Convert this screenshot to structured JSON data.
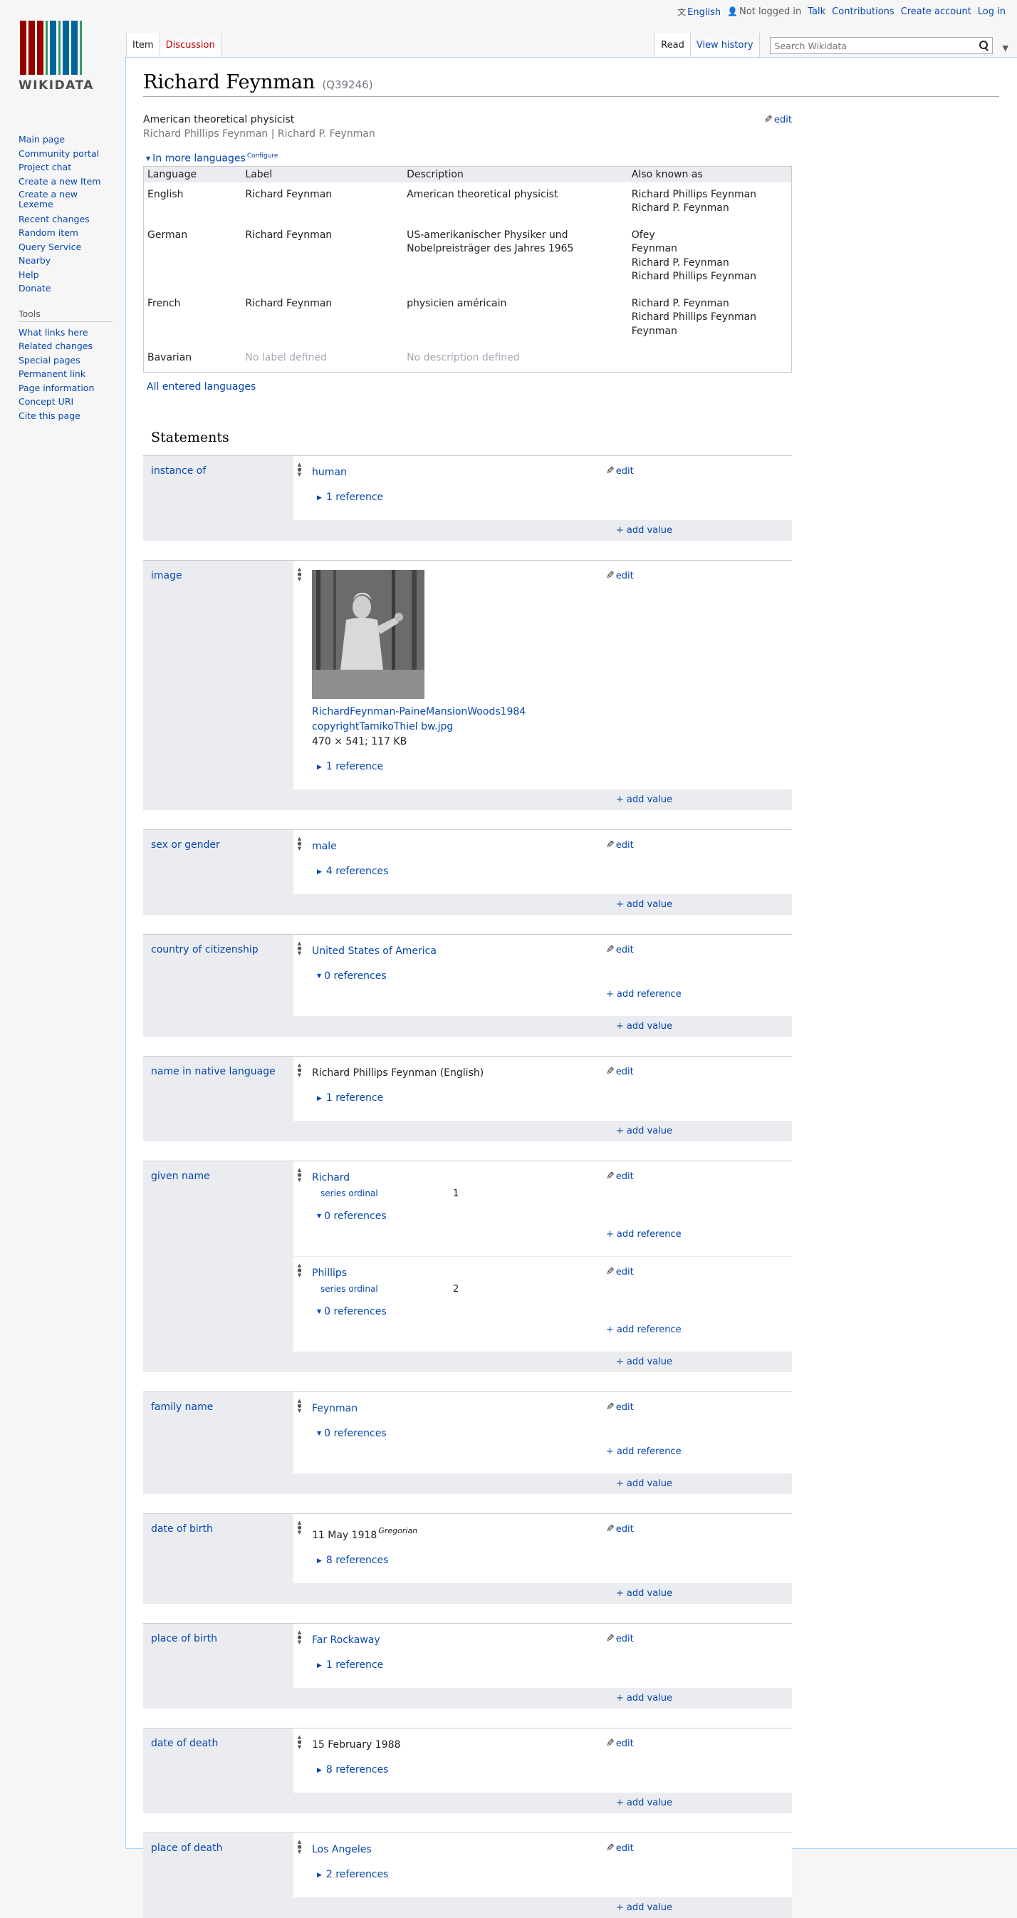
{
  "colors": {
    "link": "#0645ad",
    "tab_red": "#ba0000",
    "muted": "#72777d",
    "group_bg": "#eaecf0"
  },
  "personal": {
    "language": "English",
    "not_logged_in": "Not logged in",
    "talk": "Talk",
    "contributions": "Contributions",
    "create_account": "Create account",
    "log_in": "Log in"
  },
  "logo": {
    "text": "WIKIDATA",
    "bar_colors": [
      "#990000",
      "#990000",
      "#990000",
      "#339966",
      "#006699",
      "#339966",
      "#006699",
      "#006699",
      "#339966"
    ]
  },
  "tabs": {
    "item": "Item",
    "discussion": "Discussion",
    "read": "Read",
    "view_history": "View history",
    "more_icon": "chevron-down-icon"
  },
  "search": {
    "placeholder": "Search Wikidata"
  },
  "nav": {
    "items": [
      "Main page",
      "Community portal",
      "Project chat",
      "Create a new Item",
      "Create a new Lexeme",
      "Recent changes",
      "Random item",
      "Query Service",
      "Nearby",
      "Help",
      "Donate"
    ],
    "tools_heading": "Tools",
    "tools": [
      "What links here",
      "Related changes",
      "Special pages",
      "Permanent link",
      "Page information",
      "Concept URI",
      "Cite this page"
    ]
  },
  "page": {
    "title": "Richard Feynman",
    "qid": "(Q39246)",
    "description": "American theoretical physicist",
    "aliases": "Richard Phillips Feynman | Richard P. Feynman",
    "edit": "edit",
    "in_more_languages": "In more languages",
    "configure": "Configure",
    "all_entered_languages": "All entered languages",
    "statements_heading": "Statements"
  },
  "lang_table": {
    "headers": [
      "Language",
      "Label",
      "Description",
      "Also known as"
    ],
    "rows": [
      {
        "language": "English",
        "label": "Richard Feynman",
        "description": "American theoretical physicist",
        "aliases": [
          "Richard Phillips Feynman",
          "Richard P. Feynman"
        ]
      },
      {
        "language": "German",
        "label": "Richard Feynman",
        "description": "US-amerikanischer Physiker und Nobelpreisträger des Jahres 1965",
        "aliases": [
          "Ofey",
          "Feynman",
          "Richard P. Feynman",
          "Richard Phillips Feynman"
        ]
      },
      {
        "language": "French",
        "label": "Richard Feynman",
        "description": "physicien américain",
        "aliases": [
          "Richard P. Feynman",
          "Richard Phillips Feynman",
          "Feynman"
        ]
      },
      {
        "language": "Bavarian",
        "label": "No label defined",
        "description": "No description defined",
        "aliases": []
      }
    ]
  },
  "labels": {
    "add_value": "add value",
    "add_reference": "add reference",
    "edit": "edit"
  },
  "statements": [
    {
      "property": "instance of",
      "claims": [
        {
          "value": "human",
          "link": true,
          "refs": "1 reference",
          "expanded": false
        }
      ]
    },
    {
      "property": "image",
      "claims": [
        {
          "image": true,
          "file_line1": "RichardFeynman-PaineMansionWoods1984",
          "file_line2": "copyrightTamikoThiel bw.jpg",
          "file_info": "470 × 541; 117 KB",
          "refs": "1 reference",
          "expanded": false
        }
      ]
    },
    {
      "property": "sex or gender",
      "claims": [
        {
          "value": "male",
          "link": true,
          "refs": "4 references",
          "expanded": false
        }
      ]
    },
    {
      "property": "country of citizenship",
      "claims": [
        {
          "value": "United States of America",
          "link": true,
          "refs": "0 references",
          "expanded": true
        }
      ]
    },
    {
      "property": "name in native language",
      "claims": [
        {
          "value": "Richard Phillips Feynman (English)",
          "link": false,
          "refs": "1 reference",
          "expanded": false
        }
      ]
    },
    {
      "property": "given name",
      "claims": [
        {
          "value": "Richard",
          "link": true,
          "qual_prop": "series ordinal",
          "qual_val": "1",
          "refs": "0 references",
          "expanded": true
        },
        {
          "value": "Phillips",
          "link": true,
          "qual_prop": "series ordinal",
          "qual_val": "2",
          "refs": "0 references",
          "expanded": true
        }
      ]
    },
    {
      "property": "family name",
      "claims": [
        {
          "value": "Feynman",
          "link": true,
          "refs": "0 references",
          "expanded": true
        }
      ]
    },
    {
      "property": "date of birth",
      "claims": [
        {
          "value": "11 May 1918",
          "calendar": "Gregorian",
          "link": false,
          "refs": "8 references",
          "expanded": false
        }
      ]
    },
    {
      "property": "place of birth",
      "claims": [
        {
          "value": "Far Rockaway",
          "link": true,
          "refs": "1 reference",
          "expanded": false
        }
      ]
    },
    {
      "property": "date of death",
      "claims": [
        {
          "value": "15 February 1988",
          "link": false,
          "refs": "8 references",
          "expanded": false
        }
      ]
    },
    {
      "property": "place of death",
      "claims": [
        {
          "value": "Los Angeles",
          "link": true,
          "refs": "2 references",
          "expanded": false
        }
      ]
    }
  ]
}
